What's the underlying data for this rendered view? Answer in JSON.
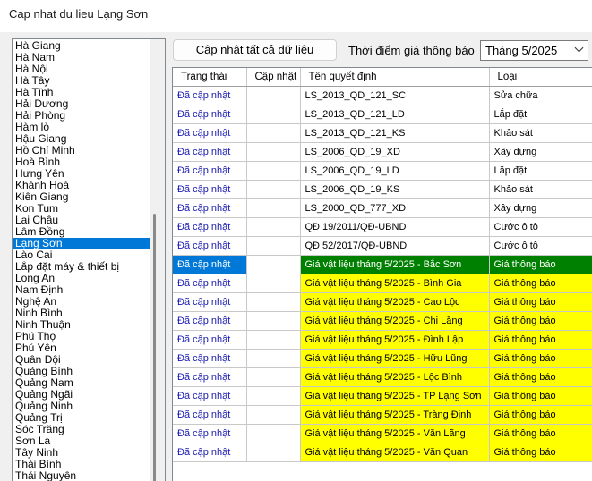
{
  "window": {
    "title": "Cap nhat du lieu Lạng Sơn"
  },
  "provinces": {
    "items": [
      "Hà Giang",
      "Hà Nam",
      "Hà Nội",
      "Hà Tây",
      "Hà Tĩnh",
      "Hải Dương",
      "Hải Phòng",
      "Hàm lò",
      "Hậu Giang",
      "Hồ Chí Minh",
      "Hoà Bình",
      "Hưng Yên",
      "Khánh Hoà",
      "Kiên Giang",
      "Kon Tum",
      "Lai Châu",
      "Lâm Đồng",
      "Lạng Sơn",
      "Lào Cai",
      "Lắp đặt máy & thiết bị",
      "Long An",
      "Nam Định",
      "Nghệ An",
      "Ninh Bình",
      "Ninh Thuận",
      "Phú Thọ",
      "Phú Yên",
      "Quân Đội",
      "Quảng Bình",
      "Quảng Nam",
      "Quảng Ngãi",
      "Quảng Ninh",
      "Quảng Trị",
      "Sóc Trăng",
      "Sơn La",
      "Tây Ninh",
      "Thái Bình",
      "Thái Nguyên"
    ],
    "selected": "Lạng Sơn"
  },
  "toolbar": {
    "update_all_label": "Cập nhật tất cả dữ liệu",
    "price_time_label": "Thời điểm giá thông báo",
    "month_value": "Tháng 5/2025"
  },
  "grid": {
    "columns": [
      "Trạng thái",
      "Cập nhật",
      "Tên quyết định",
      "Loại"
    ],
    "rows": [
      {
        "status": "Đã cập nhật",
        "update": "",
        "name": "LS_2013_QD_121_SC",
        "type": "Sửa chữa",
        "highlight": ""
      },
      {
        "status": "Đã cập nhật",
        "update": "",
        "name": "LS_2013_QD_121_LD",
        "type": "Lắp đặt",
        "highlight": ""
      },
      {
        "status": "Đã cập nhật",
        "update": "",
        "name": "LS_2013_QD_121_KS",
        "type": "Khảo sát",
        "highlight": ""
      },
      {
        "status": "Đã cập nhật",
        "update": "",
        "name": "LS_2006_QD_19_XD",
        "type": "Xây dựng",
        "highlight": ""
      },
      {
        "status": "Đã cập nhật",
        "update": "",
        "name": "LS_2006_QD_19_LD",
        "type": "Lắp đặt",
        "highlight": ""
      },
      {
        "status": "Đã cập nhật",
        "update": "",
        "name": "LS_2006_QD_19_KS",
        "type": "Khảo sát",
        "highlight": ""
      },
      {
        "status": "Đã cập nhật",
        "update": "",
        "name": "LS_2000_QD_777_XD",
        "type": "Xây dựng",
        "highlight": ""
      },
      {
        "status": "Đã cập nhật",
        "update": "",
        "name": "QĐ 19/2011/QĐ-UBND",
        "type": "Cước ô tô",
        "highlight": ""
      },
      {
        "status": "Đã cập nhật",
        "update": "",
        "name": "QĐ 52/2017/QĐ-UBND",
        "type": "Cước ô tô",
        "highlight": ""
      },
      {
        "status": "Đã cập nhật",
        "update": "",
        "name": "Giá vật liệu tháng 5/2025 - Bắc Sơn",
        "type": "Giá thông báo",
        "highlight": "sel"
      },
      {
        "status": "Đã cập nhật",
        "update": "",
        "name": "Giá vật liệu tháng 5/2025 - Bình Gia",
        "type": "Giá thông báo",
        "highlight": "new"
      },
      {
        "status": "Đã cập nhật",
        "update": "",
        "name": "Giá vật liệu tháng 5/2025 - Cao Lộc",
        "type": "Giá thông báo",
        "highlight": "new"
      },
      {
        "status": "Đã cập nhật",
        "update": "",
        "name": "Giá vật liệu tháng 5/2025 - Chi Lăng",
        "type": "Giá thông báo",
        "highlight": "new"
      },
      {
        "status": "Đã cập nhật",
        "update": "",
        "name": "Giá vật liệu tháng 5/2025 - Đình Lập",
        "type": "Giá thông báo",
        "highlight": "new"
      },
      {
        "status": "Đã cập nhật",
        "update": "",
        "name": "Giá vật liệu tháng 5/2025 - Hữu Lũng",
        "type": "Giá thông báo",
        "highlight": "new"
      },
      {
        "status": "Đã cập nhật",
        "update": "",
        "name": "Giá vật liệu tháng 5/2025 - Lộc Bình",
        "type": "Giá thông báo",
        "highlight": "new"
      },
      {
        "status": "Đã cập nhật",
        "update": "",
        "name": "Giá vật liệu tháng 5/2025 - TP Lạng Sơn",
        "type": "Giá thông báo",
        "highlight": "new"
      },
      {
        "status": "Đã cập nhật",
        "update": "",
        "name": "Giá vật liệu tháng 5/2025 - Tràng Định",
        "type": "Giá thông báo",
        "highlight": "new"
      },
      {
        "status": "Đã cập nhật",
        "update": "",
        "name": "Giá vật liệu tháng 5/2025 - Văn Lãng",
        "type": "Giá thông báo",
        "highlight": "new"
      },
      {
        "status": "Đã cập nhật",
        "update": "",
        "name": "Giá vật liệu tháng 5/2025 - Văn Quan",
        "type": "Giá thông báo",
        "highlight": "new"
      }
    ]
  },
  "colors": {
    "selection_blue": "#0078d7",
    "highlight_yellow": "#ffff00",
    "selected_green": "#008000",
    "status_text": "#1a1ab0"
  }
}
